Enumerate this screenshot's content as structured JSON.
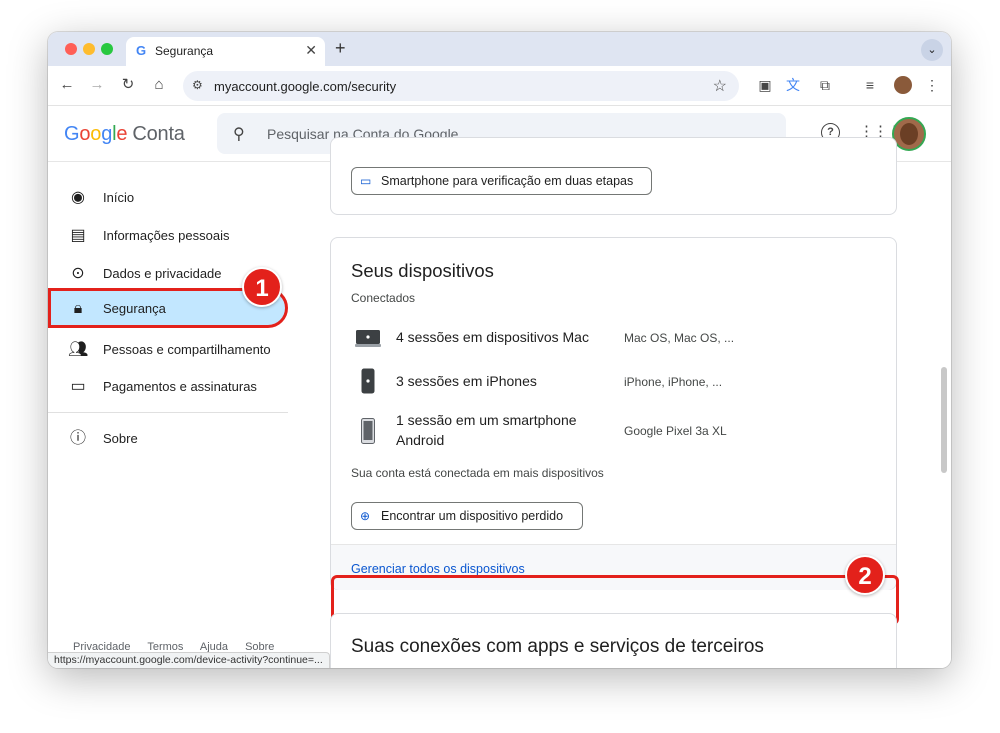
{
  "browser": {
    "tab": {
      "favicon": "G",
      "title": "Segurança",
      "close": "✕"
    },
    "new_tab": "+",
    "tab_menu": "⌄",
    "url": "myaccount.google.com/security",
    "status_url": "https://myaccount.google.com/device-activity?continue=..."
  },
  "header": {
    "logo_google": [
      "G",
      "o",
      "o",
      "g",
      "l",
      "e"
    ],
    "logo_conta": "Conta",
    "search_placeholder": "Pesquisar na Conta do Google"
  },
  "sidebar": {
    "items": [
      {
        "label": "Início",
        "icon": "account-circle-icon"
      },
      {
        "label": "Informações pessoais",
        "icon": "id-card-icon"
      },
      {
        "label": "Dados e privacidade",
        "icon": "toggle-icon"
      },
      {
        "label": "Segurança",
        "icon": "lock-icon",
        "active": true
      },
      {
        "label": "Pessoas e compartilhamento",
        "icon": "people-icon"
      },
      {
        "label": "Pagamentos e assinaturas",
        "icon": "credit-card-icon"
      },
      {
        "label": "Sobre",
        "icon": "info-icon"
      }
    ],
    "footer": [
      "Privacidade",
      "Termos",
      "Ajuda",
      "Sobre"
    ]
  },
  "two_step_card": {
    "button": "Smartphone para verificação em duas etapas"
  },
  "devices_card": {
    "title": "Seus dispositivos",
    "subtitle": "Conectados",
    "devices": [
      {
        "name": "4 sessões em dispositivos Mac",
        "detail": "Mac OS, Mac OS, ...",
        "icon": "laptop-icon"
      },
      {
        "name": "3 sessões em iPhones",
        "detail": "iPhone, iPhone, ...",
        "icon": "iphone-icon"
      },
      {
        "name": "1 sessão em um smartphone Android",
        "detail": "Google Pixel 3a XL",
        "icon": "android-phone-icon"
      }
    ],
    "note": "Sua conta está conectada em mais dispositivos",
    "find_button": "Encontrar um dispositivo perdido",
    "manage_link": "Gerenciar todos os dispositivos"
  },
  "third_party_card": {
    "title": "Suas conexões com apps e serviços de terceiros"
  },
  "annotations": {
    "badge_1": "1",
    "badge_2": "2",
    "highlight_color": "#e3211b"
  },
  "colors": {
    "active_nav": "#c2e7ff",
    "link": "#0b57d0",
    "tabstrip": "#dfe5f2"
  }
}
